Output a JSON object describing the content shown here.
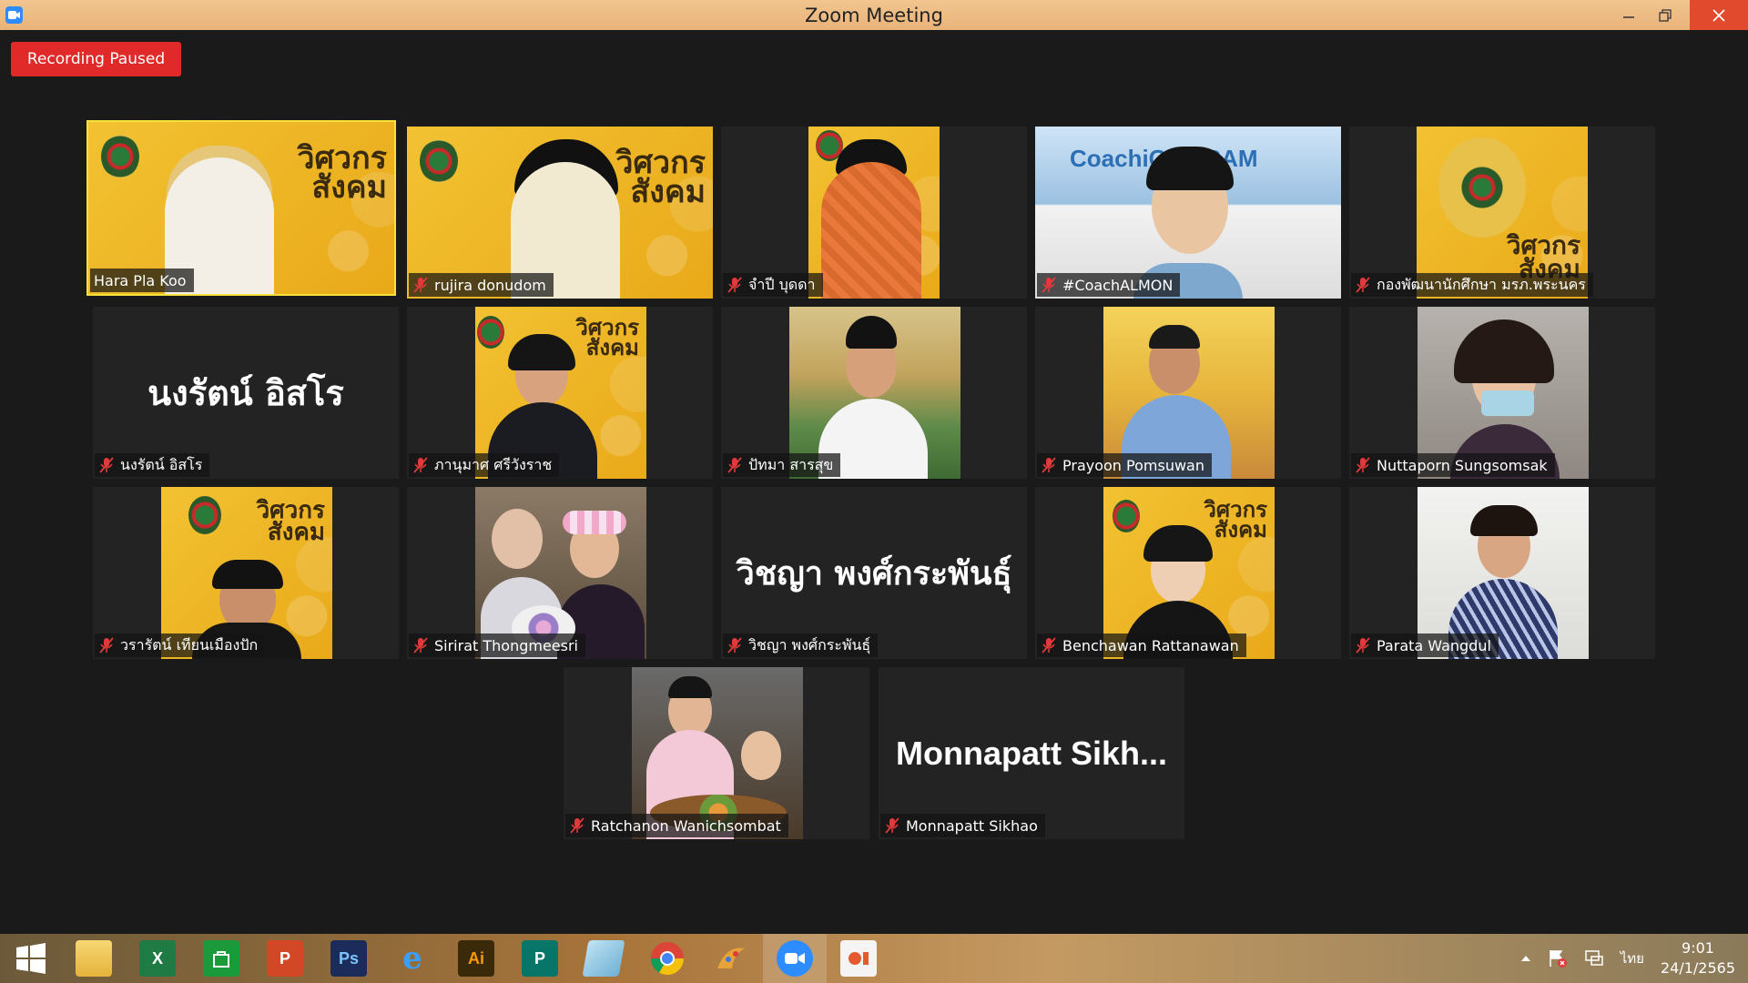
{
  "window": {
    "title": "Zoom Meeting",
    "app_icon": "zoom-camera-icon"
  },
  "recording": {
    "label": "Recording Paused",
    "color": "#e02a2a"
  },
  "participants": [
    {
      "name": "Hara Pla Koo",
      "muted": false,
      "active": true
    },
    {
      "name": "rujira donudom",
      "muted": true
    },
    {
      "name": "จำปี บุดดา",
      "muted": true
    },
    {
      "name": "#CoachALMON",
      "muted": true,
      "video_text": "CoachiGOGRAM"
    },
    {
      "name": "กองพัฒนานักศึกษา มรภ.พระนคร",
      "muted": true
    },
    {
      "name": "นงรัตน์ อิสโร",
      "muted": true,
      "display_name": "นงรัตน์ อิสโร"
    },
    {
      "name": "ภานุมาศ ศรีวังราช",
      "muted": true
    },
    {
      "name": "ปัทมา สารสุข",
      "muted": true
    },
    {
      "name": "Prayoon Pomsuwan",
      "muted": true
    },
    {
      "name": "Nuttaporn Sungsomsak",
      "muted": true
    },
    {
      "name": "วรารัตน์ เทียนเมืองปัก",
      "muted": true
    },
    {
      "name": "Sirirat Thongmeesri",
      "muted": true
    },
    {
      "name": "วิชญา พงศ์กระพันธุ์",
      "muted": true,
      "display_name": "วิชญา พงศ์กระพันธุ์"
    },
    {
      "name": "Benchawan Rattanawan",
      "muted": true
    },
    {
      "name": "Parata Wangdul",
      "muted": true
    },
    {
      "name": "Ratchanon Wanichsombat",
      "muted": true
    },
    {
      "name": "Monnapatt Sikhao",
      "muted": true,
      "display_name": "Monnapatt Sikh..."
    }
  ],
  "poster": {
    "line1": "วิศวกร",
    "line2": "สังคม"
  },
  "taskbar": {
    "apps": [
      "windows-start-icon",
      "file-explorer-icon",
      "excel-icon",
      "store-icon",
      "powerpoint-icon",
      "photoshop-icon",
      "internet-explorer-icon",
      "illustrator-icon",
      "publisher-icon",
      "notepad-icon",
      "chrome-icon",
      "paint-icon",
      "zoom-icon",
      "slides-icon"
    ],
    "labels": {
      "excel": "X",
      "photoshop": "Ps",
      "illustrator": "Ai",
      "publisher": "P",
      "powerpoint": "P"
    },
    "language": "ไทย",
    "time": "9:01",
    "date": "24/1/2565"
  },
  "colors": {
    "active_border": "#f6e23a",
    "titlebar": "#e8b37a",
    "background": "#1a1a1a"
  }
}
